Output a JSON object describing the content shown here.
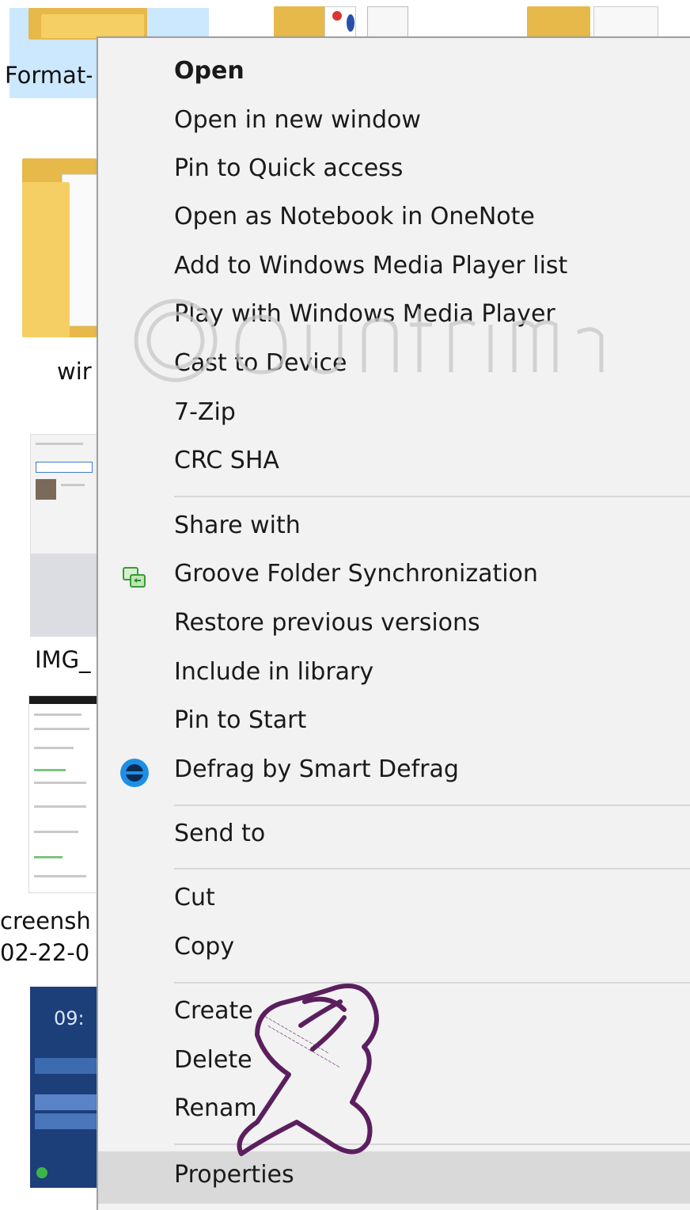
{
  "explorer": {
    "tiles": [
      {
        "label": "Format-"
      },
      {
        "label": "wir"
      },
      {
        "label": "IMG_"
      },
      {
        "label": "creensh"
      },
      {
        "label": "02-22-0"
      }
    ],
    "selection_color": "#cce8ff"
  },
  "context_menu": {
    "groups": [
      [
        {
          "label": "Open",
          "bold": true
        },
        {
          "label": "Open in new window"
        },
        {
          "label": "Pin to Quick access"
        },
        {
          "label": "Open as Notebook in OneNote"
        },
        {
          "label": "Add to Windows Media Player list"
        },
        {
          "label": "Play with Windows Media Player"
        },
        {
          "label": "Cast to Device"
        },
        {
          "label": "7-Zip"
        },
        {
          "label": "CRC SHA"
        }
      ],
      [
        {
          "label": "Share with"
        },
        {
          "label": "Groove Folder Synchronization",
          "icon": "groove-sync-icon"
        },
        {
          "label": "Restore previous versions"
        },
        {
          "label": "Include in library"
        },
        {
          "label": "Pin to Start"
        },
        {
          "label": "Defrag by Smart Defrag",
          "icon": "smart-defrag-icon"
        }
      ],
      [
        {
          "label": "Send to"
        }
      ],
      [
        {
          "label": "Cut"
        },
        {
          "label": "Copy"
        }
      ],
      [
        {
          "label": "Create"
        },
        {
          "label": "Delete"
        },
        {
          "label": "Renam"
        }
      ],
      [
        {
          "label": "Properties",
          "hover": true
        }
      ]
    ],
    "hover_color": "#d9d9d9",
    "background": "#f2f2f2"
  },
  "watermark": {
    "brand": "Quantrimang"
  },
  "overlay": {
    "icon": "pointing-hand-icon",
    "color": "#5b1f5e"
  }
}
